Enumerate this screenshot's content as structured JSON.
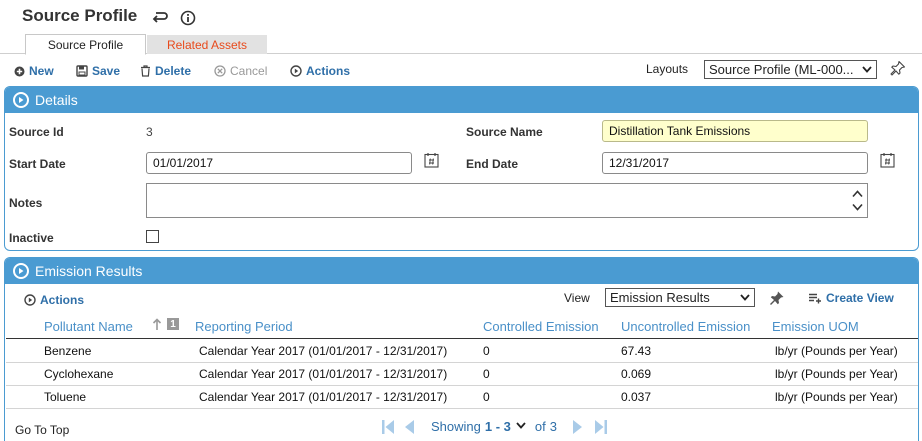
{
  "page": {
    "title": "Source Profile"
  },
  "tabs": [
    {
      "label": "Source Profile",
      "active": true
    },
    {
      "label": "Related Assets",
      "active": false
    }
  ],
  "toolbar": {
    "new_label": "New",
    "save_label": "Save",
    "delete_label": "Delete",
    "cancel_label": "Cancel",
    "actions_label": "Actions",
    "layouts_label": "Layouts",
    "layout_value": "Source Profile (ML-000..."
  },
  "details": {
    "header": "Details",
    "source_id_label": "Source Id",
    "source_id_value": "3",
    "source_name_label": "Source Name",
    "source_name_value": "Distillation Tank Emissions",
    "start_date_label": "Start Date",
    "start_date_value": "01/01/2017",
    "end_date_label": "End Date",
    "end_date_value": "12/31/2017",
    "notes_label": "Notes",
    "notes_value": "",
    "inactive_label": "Inactive"
  },
  "results": {
    "header": "Emission Results",
    "actions_label": "Actions",
    "view_label": "View",
    "view_value": "Emission Results",
    "create_view_label": "Create View",
    "sort_rank": "1",
    "columns": [
      "Pollutant Name",
      "Reporting Period",
      "Controlled Emission",
      "Uncontrolled Emission",
      "Emission UOM"
    ],
    "rows": [
      [
        "Benzene",
        "Calendar Year 2017 (01/01/2017 - 12/31/2017)",
        "0",
        "67.43",
        "lb/yr (Pounds per Year)"
      ],
      [
        "Cyclohexane",
        "Calendar Year 2017 (01/01/2017 - 12/31/2017)",
        "0",
        "0.069",
        "lb/yr (Pounds per Year)"
      ],
      [
        "Toluene",
        "Calendar Year 2017 (01/01/2017 - 12/31/2017)",
        "0",
        "0.037",
        "lb/yr (Pounds per Year)"
      ]
    ],
    "go_to_top": "Go To Top",
    "pager": {
      "showing": "Showing",
      "range": "1 - 3",
      "of": "of",
      "total": "3"
    }
  },
  "colors": {
    "accent": "#4a9bd2",
    "link": "#2f6fa8",
    "tab_alert": "#e84a1c"
  }
}
